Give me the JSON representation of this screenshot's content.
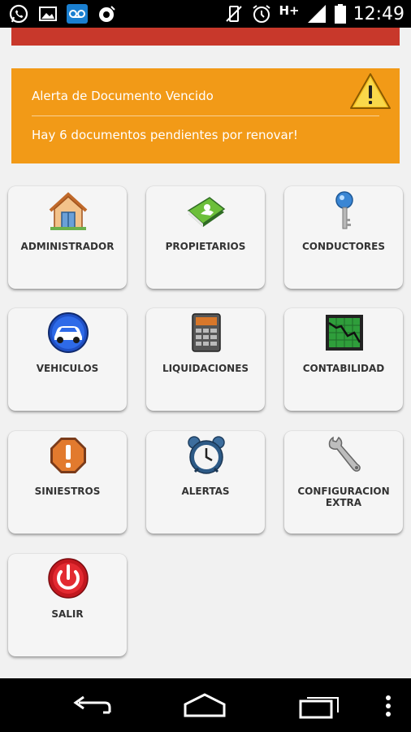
{
  "status_bar": {
    "network": "H+",
    "time": "12:49",
    "icons": [
      "whatsapp-icon",
      "gallery-icon",
      "voicemail-icon",
      "alarm-sync-icon",
      "vibrate-off-icon",
      "alarm-clock-icon",
      "signal-icon",
      "battery-icon"
    ]
  },
  "alert": {
    "title": "Alerta de Documento Vencido",
    "message": "Hay 6 documentos pendientes por renovar!",
    "icon": "warning-icon",
    "color": "#f29a17"
  },
  "menu": [
    {
      "label": "ADMINISTRADOR",
      "icon": "house-icon"
    },
    {
      "label": "PROPIETARIOS",
      "icon": "address-book-icon"
    },
    {
      "label": "CONDUCTORES",
      "icon": "key-icon"
    },
    {
      "label": "VEHICULOS",
      "icon": "car-icon"
    },
    {
      "label": "LIQUIDACIONES",
      "icon": "calculator-icon"
    },
    {
      "label": "CONTABILIDAD",
      "icon": "chart-icon"
    },
    {
      "label": "SINIESTROS",
      "icon": "stop-warning-icon"
    },
    {
      "label": "ALERTAS",
      "icon": "alarm-clock-icon"
    },
    {
      "label": "CONFIGURACION EXTRA",
      "icon": "wrench-icon"
    },
    {
      "label": "SALIR",
      "icon": "power-icon"
    }
  ],
  "nav_bar": {
    "buttons": [
      "back-icon",
      "home-icon",
      "recents-icon",
      "overflow-menu-icon"
    ]
  },
  "colors": {
    "header_red": "#c8382b",
    "alert_orange": "#f29a17"
  }
}
